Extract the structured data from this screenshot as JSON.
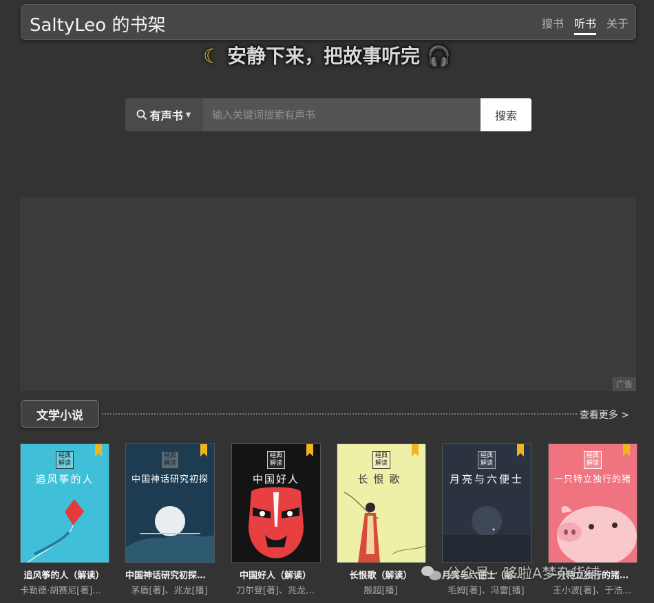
{
  "header": {
    "brand": "SaltyLeo 的书架",
    "tabs": [
      {
        "label": "搜书",
        "active": false
      },
      {
        "label": "听书",
        "active": true
      },
      {
        "label": "关于",
        "active": false
      }
    ]
  },
  "slogan": {
    "icon": "moon-icon",
    "text": "安静下来，把故事听完",
    "trailing_icon": "headphones-icon"
  },
  "search": {
    "type_label": "有声书",
    "placeholder": "输入关键词搜索有声书",
    "value": "",
    "button_label": "搜索"
  },
  "ad": {
    "label": "广告"
  },
  "section": {
    "title": "文学小说",
    "more_label": "查看更多 >"
  },
  "books": [
    {
      "cover_title": "追风筝的人",
      "seal": "经典解读",
      "name": "追风筝的人（解读）",
      "author": "卡勒德·胡赛尼[著]、…"
    },
    {
      "cover_title": "中国神话研究初探",
      "seal": "经典解读",
      "name": "中国神话研究初探（解读）",
      "author": "茅盾[著]、兆龙[播]"
    },
    {
      "cover_title": "中国好人",
      "seal": "经典解读",
      "name": "中国好人（解读）",
      "author": "刀尔登[著]、兆龙…"
    },
    {
      "cover_title": "长恨歌",
      "seal": "经典解读",
      "name": "长恨歌（解读）",
      "author": "殷超[播]"
    },
    {
      "cover_title": "月亮与六便士",
      "seal": "经典解读",
      "name": "月亮与六便士（解读）",
      "author": "毛姆[著]、冯雷[播]"
    },
    {
      "cover_title": "一只特立独行的猪",
      "seal": "经典解读",
      "name": "一只特立独行的猪（解读）",
      "author": "王小波[著]、于浩…"
    }
  ],
  "watermark": {
    "text": "公众号 · 哆啦A梦杂货铺",
    "icon": "wechat-icon"
  },
  "colors": {
    "background": "#333333",
    "navbar": "#474747",
    "accent_moon": "#f2c230",
    "bookmark": "#f0b420"
  }
}
